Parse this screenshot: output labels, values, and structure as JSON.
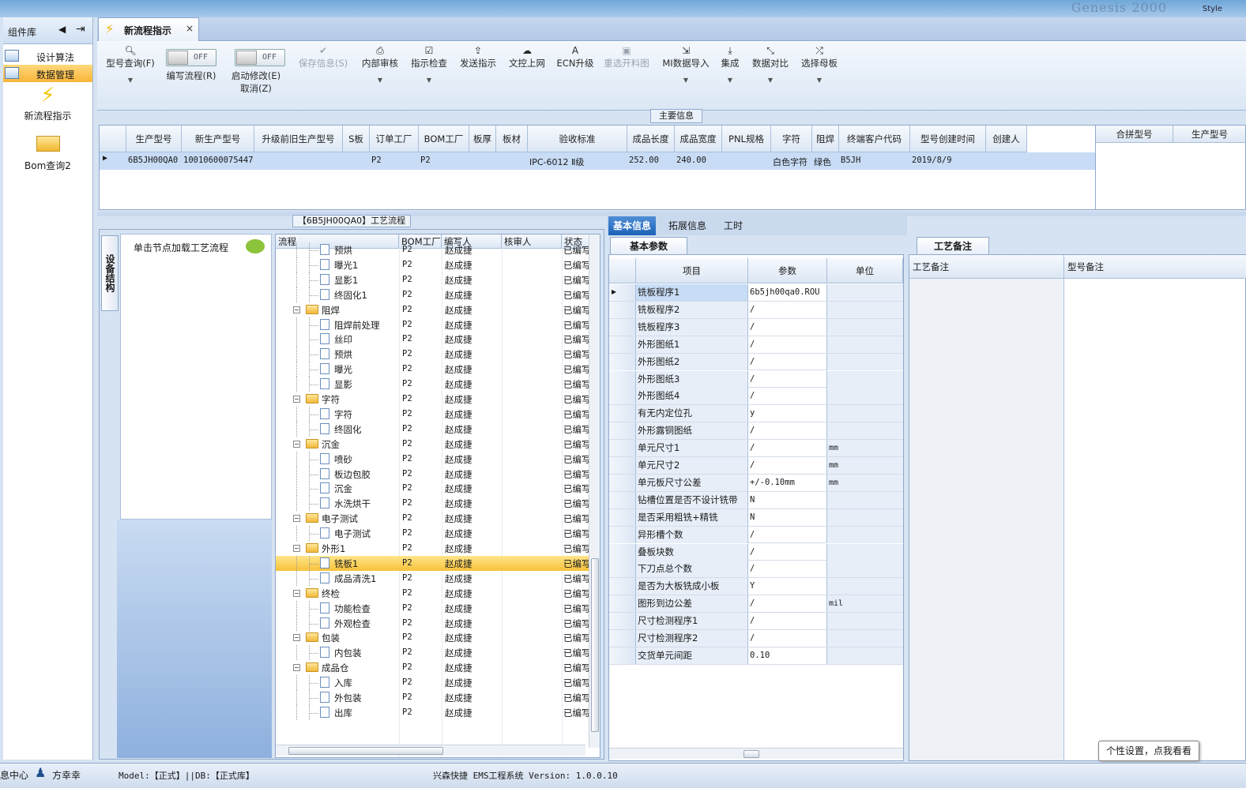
{
  "window": {
    "brand_text": "Genesis 2000",
    "style_label": "Style"
  },
  "left_panel": {
    "title": "组件库",
    "items": [
      {
        "label": "设计算法"
      },
      {
        "label": "数据管理",
        "selected": true
      }
    ],
    "launchers": [
      {
        "label": "新流程指示",
        "icon": "lightning-icon"
      },
      {
        "label": "Bom查询2",
        "icon": "folder-open-icon"
      }
    ]
  },
  "tab": {
    "label": "新流程指示",
    "close": "×"
  },
  "toolbar": {
    "query": "型号查询(F)",
    "write_flow": {
      "label": "编写流程(R)",
      "state": "OFF"
    },
    "start_modify": {
      "label_line1": "启动修改(E)",
      "label_line2": "取消(Z)",
      "state": "OFF"
    },
    "save": "保存信息(S)",
    "review": "内部审核",
    "check": "指示检查",
    "send": "发送指示",
    "upload": "文控上网",
    "ecn": "ECN升级",
    "reselect": "重选开料图",
    "mi_import": "MI数据导入",
    "integrate": "集成",
    "compare": "数据对比",
    "select_master": "选择母板"
  },
  "main_info": {
    "section_label": "主要信息",
    "columns": [
      "生产型号",
      "新生产型号",
      "升级前旧生产型号",
      "S板",
      "订单工厂",
      "BOM工厂",
      "板厚",
      "板材",
      "验收标准",
      "成品长度",
      "成品宽度",
      "PNL规格",
      "字符",
      "阻焊",
      "终端客户代码",
      "型号创建时间",
      "创建人"
    ],
    "row": [
      "6B5JH00QA0",
      "10010600075447",
      "",
      "",
      "P2",
      "P2",
      "",
      "",
      "IPC-6012 Ⅱ级",
      "252.00",
      "240.00",
      "",
      "白色字符",
      "绿色",
      "B5JH",
      "2019/8/9",
      ""
    ],
    "right_columns": [
      "合拼型号",
      "生产型号"
    ]
  },
  "flow": {
    "header": "【6B5JH00QA0】工艺流程",
    "side_tab": "设备结构",
    "hint": "单击节点加载工艺流程",
    "columns": [
      "流程",
      "BOM工厂",
      "编写人",
      "核审人",
      "状态"
    ],
    "rows": [
      {
        "name": "预烘",
        "level": 2,
        "bom": "P2",
        "author": "赵成捷",
        "status": "已编写"
      },
      {
        "name": "曝光1",
        "level": 2,
        "bom": "P2",
        "author": "赵成捷",
        "status": "已编写"
      },
      {
        "name": "显影1",
        "level": 2,
        "bom": "P2",
        "author": "赵成捷",
        "status": "已编写"
      },
      {
        "name": "终固化1",
        "level": 2,
        "bom": "P2",
        "author": "赵成捷",
        "status": "已编写"
      },
      {
        "name": "阻焊",
        "level": 1,
        "bom": "P2",
        "author": "赵成捷",
        "status": "已编写"
      },
      {
        "name": "阻焊前处理",
        "level": 2,
        "bom": "P2",
        "author": "赵成捷",
        "status": "已编写"
      },
      {
        "name": "丝印",
        "level": 2,
        "bom": "P2",
        "author": "赵成捷",
        "status": "已编写"
      },
      {
        "name": "预烘",
        "level": 2,
        "bom": "P2",
        "author": "赵成捷",
        "status": "已编写"
      },
      {
        "name": "曝光",
        "level": 2,
        "bom": "P2",
        "author": "赵成捷",
        "status": "已编写"
      },
      {
        "name": "显影",
        "level": 2,
        "bom": "P2",
        "author": "赵成捷",
        "status": "已编写"
      },
      {
        "name": "字符",
        "level": 1,
        "bom": "P2",
        "author": "赵成捷",
        "status": "已编写"
      },
      {
        "name": "字符",
        "level": 2,
        "bom": "P2",
        "author": "赵成捷",
        "status": "已编写"
      },
      {
        "name": "终固化",
        "level": 2,
        "bom": "P2",
        "author": "赵成捷",
        "status": "已编写"
      },
      {
        "name": "沉金",
        "level": 1,
        "bom": "P2",
        "author": "赵成捷",
        "status": "已编写"
      },
      {
        "name": "喷砂",
        "level": 2,
        "bom": "P2",
        "author": "赵成捷",
        "status": "已编写"
      },
      {
        "name": "板边包胶",
        "level": 2,
        "bom": "P2",
        "author": "赵成捷",
        "status": "已编写"
      },
      {
        "name": "沉金",
        "level": 2,
        "bom": "P2",
        "author": "赵成捷",
        "status": "已编写"
      },
      {
        "name": "水洗烘干",
        "level": 2,
        "bom": "P2",
        "author": "赵成捷",
        "status": "已编写"
      },
      {
        "name": "电子测试",
        "level": 1,
        "bom": "P2",
        "author": "赵成捷",
        "status": "已编写"
      },
      {
        "name": "电子测试",
        "level": 2,
        "bom": "P2",
        "author": "赵成捷",
        "status": "已编写"
      },
      {
        "name": "外形1",
        "level": 1,
        "bom": "P2",
        "author": "赵成捷",
        "status": "已编写"
      },
      {
        "name": "铣板1",
        "level": 2,
        "bom": "P2",
        "author": "赵成捷",
        "status": "已编写",
        "selected": true
      },
      {
        "name": "成品清洗1",
        "level": 2,
        "bom": "P2",
        "author": "赵成捷",
        "status": "已编写"
      },
      {
        "name": "终检",
        "level": 1,
        "bom": "P2",
        "author": "赵成捷",
        "status": "已编写"
      },
      {
        "name": "功能检查",
        "level": 2,
        "bom": "P2",
        "author": "赵成捷",
        "status": "已编写"
      },
      {
        "name": "外观检查",
        "level": 2,
        "bom": "P2",
        "author": "赵成捷",
        "status": "已编写"
      },
      {
        "name": "包装",
        "level": 1,
        "bom": "P2",
        "author": "赵成捷",
        "status": "已编写"
      },
      {
        "name": "内包装",
        "level": 2,
        "bom": "P2",
        "author": "赵成捷",
        "status": "已编写"
      },
      {
        "name": "成品仓",
        "level": 1,
        "bom": "P2",
        "author": "赵成捷",
        "status": "已编写"
      },
      {
        "name": "入库",
        "level": 2,
        "bom": "P2",
        "author": "赵成捷",
        "status": "已编写"
      },
      {
        "name": "外包装",
        "level": 2,
        "bom": "P2",
        "author": "赵成捷",
        "status": "已编写"
      },
      {
        "name": "出库",
        "level": 2,
        "bom": "P2",
        "author": "赵成捷",
        "status": "已编写"
      }
    ]
  },
  "params": {
    "tabs": [
      "基本信息",
      "拓展信息",
      "工时"
    ],
    "subtab": "基本参数",
    "columns": [
      "项目",
      "参数",
      "单位"
    ],
    "rows": [
      [
        "铣板程序1",
        "6b5jh00qa0.ROU",
        ""
      ],
      [
        "铣板程序2",
        "/",
        ""
      ],
      [
        "铣板程序3",
        "/",
        ""
      ],
      [
        "外形图纸1",
        "/",
        ""
      ],
      [
        "外形图纸2",
        "/",
        ""
      ],
      [
        "外形图纸3",
        "/",
        ""
      ],
      [
        "外形图纸4",
        "/",
        ""
      ],
      [
        "有无内定位孔",
        "y",
        ""
      ],
      [
        "外形露铜图纸",
        "/",
        ""
      ],
      [
        "单元尺寸1",
        "/",
        "mm"
      ],
      [
        "单元尺寸2",
        "/",
        "mm"
      ],
      [
        "单元板尺寸公差",
        "+/-0.10mm",
        "mm"
      ],
      [
        "钻槽位置是否不设计铣带",
        "N",
        ""
      ],
      [
        "是否采用粗铣+精铣",
        "N",
        ""
      ],
      [
        "异形槽个数",
        "/",
        ""
      ],
      [
        "叠板块数",
        "/",
        ""
      ],
      [
        "下刀点总个数",
        "/",
        ""
      ],
      [
        "是否为大板铣成小板",
        "Y",
        ""
      ],
      [
        "图形到边公差",
        "/",
        "mil"
      ],
      [
        "尺寸检测程序1",
        "/",
        ""
      ],
      [
        "尺寸检测程序2",
        "/",
        ""
      ],
      [
        "交货单元间距",
        "0.10",
        ""
      ]
    ]
  },
  "notes": {
    "tab": "工艺备注",
    "col1": "工艺备注",
    "col2": "型号备注"
  },
  "tooltip": "个性设置，点我看看",
  "status": {
    "msg_center": "息中心",
    "user": "方幸幸",
    "env": "Model:【正式】||DB:【正式库】",
    "app": "兴森快捷 EMS工程系统 Version: 1.0.0.10"
  }
}
